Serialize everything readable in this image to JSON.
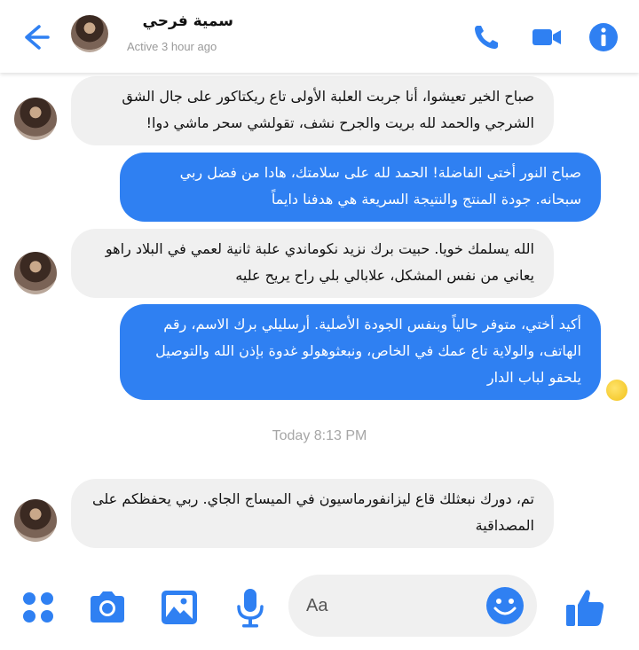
{
  "header": {
    "contact_name": "سمية فرحي",
    "status": "Active 3 hour ago",
    "icons": [
      "back-arrow-icon",
      "phone-icon",
      "video-camera-icon",
      "info-icon"
    ],
    "accent_color": "#2f80f2"
  },
  "messages": [
    {
      "direction": "in",
      "text": "صباح الخير تعيشوا، أنا جربت العلبة الأولى تاع ريكتاكور على جال الشق الشرجي والحمد لله بريت والجرح نشف، تقولشي سحر ماشي دوا!"
    },
    {
      "direction": "out",
      "text": "صباح النور أختي الفاضلة! الحمد لله على سلامتك، هادا من فضل ربي سبحانه. جودة المنتج والنتيجة السريعة هي هدفنا دايماً"
    },
    {
      "direction": "in",
      "text": "الله يسلمك خويا. حبيت برك نزيد نكوماندي علبة ثانية لعمي في البلاد راهو يعاني من نفس المشكل، علابالي بلي راح يريح عليه"
    },
    {
      "direction": "out",
      "text": "أكيد أختي، متوفر حالياً وبنفس الجودة الأصلية. أرسليلي برك الاسم، رقم الهاتف، والولاية تاع عمك في الخاص، ونبعثوهولو غدوة بإذن الله والتوصيل يلحقو لباب الدار"
    },
    {
      "direction": "in",
      "text": "تم، دورك نبعثلك قاع ليزانفورماسيون في الميساج الجاي. ربي يحفظكم على المصداقية"
    }
  ],
  "timestamp": "Today 8:13 PM",
  "composer": {
    "placeholder": "Aa",
    "icons": [
      "more-apps-icon",
      "camera-icon",
      "gallery-icon",
      "microphone-icon",
      "emoji-icon",
      "thumbs-up-icon"
    ]
  },
  "colors": {
    "outgoing_bubble": "#2f80f2",
    "incoming_bubble": "#f0f0f0",
    "timestamp_text": "#a6a6a6"
  }
}
